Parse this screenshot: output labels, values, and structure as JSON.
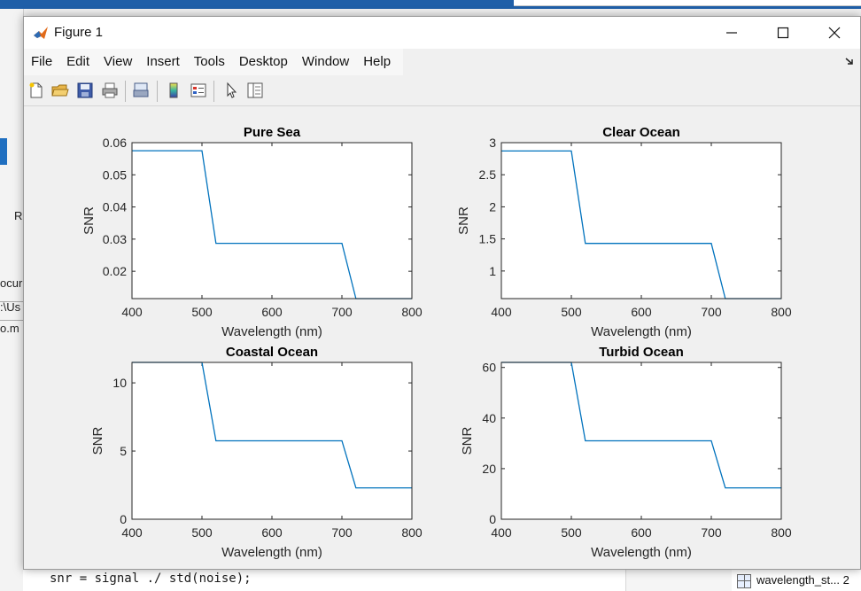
{
  "background": {
    "left_texts": [
      "R",
      "ocur",
      ":\\Us",
      "o.m"
    ],
    "code_line": "snr = signal ./ std(noise);",
    "workspace_item": "wavelength_st...",
    "workspace_value": "2"
  },
  "window": {
    "title": "Figure 1",
    "menu": [
      "File",
      "Edit",
      "View",
      "Insert",
      "Tools",
      "Desktop",
      "Window",
      "Help"
    ]
  },
  "toolbar_icons": [
    "new-figure-icon",
    "open-file-icon",
    "save-icon",
    "print-icon",
    "link-plot-icon",
    "colorbar-icon",
    "legend-icon",
    "edit-plot-icon",
    "property-inspector-icon"
  ],
  "colors": {
    "line": "#0072bd",
    "titlebar": "#ffffff",
    "axes_bg": "#ffffff"
  },
  "chart_data": [
    {
      "type": "line",
      "title": "Pure Sea",
      "xlabel": "Wavelength (nm)",
      "ylabel": "SNR",
      "xlim": [
        400,
        800
      ],
      "ylim": [
        0.0115,
        0.06
      ],
      "xticks": [
        400,
        500,
        600,
        700,
        800
      ],
      "yticks": [
        0.02,
        0.03,
        0.04,
        0.05,
        0.06
      ],
      "ytick_labels": [
        "0.02",
        "0.03",
        "0.04",
        "0.05",
        "0.06"
      ],
      "x": [
        400,
        500,
        520,
        700,
        720,
        800
      ],
      "y": [
        0.0575,
        0.0575,
        0.0287,
        0.0287,
        0.0115,
        0.0115
      ]
    },
    {
      "type": "line",
      "title": "Clear Ocean",
      "xlabel": "Wavelength (nm)",
      "ylabel": "SNR",
      "xlim": [
        400,
        800
      ],
      "ylim": [
        0.57,
        3
      ],
      "xticks": [
        400,
        500,
        600,
        700,
        800
      ],
      "yticks": [
        1,
        1.5,
        2,
        2.5,
        3
      ],
      "ytick_labels": [
        "1",
        "1.5",
        "2",
        "2.5",
        "3"
      ],
      "x": [
        400,
        500,
        520,
        700,
        720,
        800
      ],
      "y": [
        2.87,
        2.87,
        1.43,
        1.43,
        0.57,
        0.57
      ]
    },
    {
      "type": "line",
      "title": "Coastal Ocean",
      "xlabel": "Wavelength (nm)",
      "ylabel": "SNR",
      "xlim": [
        400,
        800
      ],
      "ylim": [
        0,
        11.5
      ],
      "xticks": [
        400,
        500,
        600,
        700,
        800
      ],
      "yticks": [
        0,
        5,
        10
      ],
      "ytick_labels": [
        "0",
        "5",
        "10"
      ],
      "x": [
        400,
        500,
        520,
        700,
        720,
        800
      ],
      "y": [
        11.5,
        11.5,
        5.75,
        5.75,
        2.3,
        2.3
      ]
    },
    {
      "type": "line",
      "title": "Turbid Ocean",
      "xlabel": "Wavelength (nm)",
      "ylabel": "SNR",
      "xlim": [
        400,
        800
      ],
      "ylim": [
        0,
        62
      ],
      "xticks": [
        400,
        500,
        600,
        700,
        800
      ],
      "yticks": [
        0,
        20,
        40,
        60
      ],
      "ytick_labels": [
        "0",
        "20",
        "40",
        "60"
      ],
      "x": [
        400,
        500,
        520,
        700,
        720,
        800
      ],
      "y": [
        62,
        62,
        31,
        31,
        12.4,
        12.4
      ]
    }
  ]
}
